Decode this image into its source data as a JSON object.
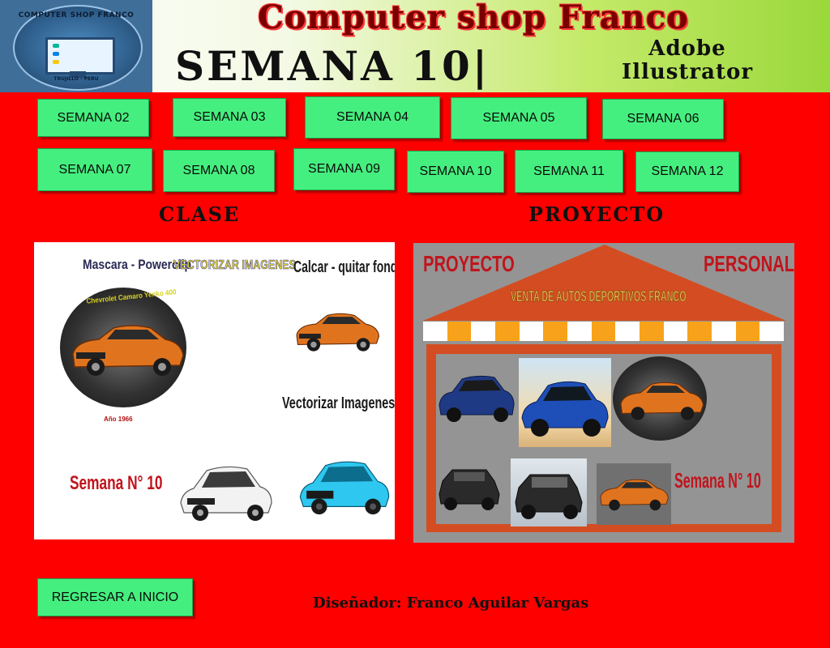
{
  "header": {
    "logo_text_top": "COMPUTER SHOP FRANCO",
    "logo_text_bottom": "TRUJILLO - PERU",
    "brand_title": "Computer shop Franco",
    "week_title": "SEMANA 10|",
    "tool_name_line1": "Adobe",
    "tool_name_line2": "Illustrator"
  },
  "weeks_row1": [
    "SEMANA 02",
    "SEMANA 03",
    "SEMANA 04",
    "SEMANA 05",
    "SEMANA 06"
  ],
  "weeks_row2": [
    "SEMANA 07",
    "SEMANA 08",
    "SEMANA 09",
    "SEMANA 10",
    "SEMANA 11",
    "SEMANA 12"
  ],
  "sections": {
    "class_label": "CLASE",
    "project_label": "PROYECTO"
  },
  "class_panel": {
    "mascara": "Mascara - Powerclip",
    "vectorizar_top": "VECTORIZAR IMAGENES",
    "calcar": "Calcar - quitar fondo",
    "car_name": "Chevrolet Camaro Yenko 400",
    "year": "Año 1966",
    "vectorizar": "Vectorizar Imagenes",
    "semana": "Semana N° 10"
  },
  "project_panel": {
    "label_left": "PROYECTO",
    "label_right": "PERSONAL",
    "store_name": "VENTA DE AUTOS DEPORTIVOS FRANCO",
    "semana": "Semana N° 10"
  },
  "footer": {
    "home_button": "REGRESAR A INICIO",
    "designer": "Diseñador: Franco Aguilar Vargas"
  },
  "colors": {
    "page_bg": "#ff0000",
    "button_green": "#45ef7f",
    "roof_orange": "#d44d22",
    "car_orange": "#e0741e"
  }
}
